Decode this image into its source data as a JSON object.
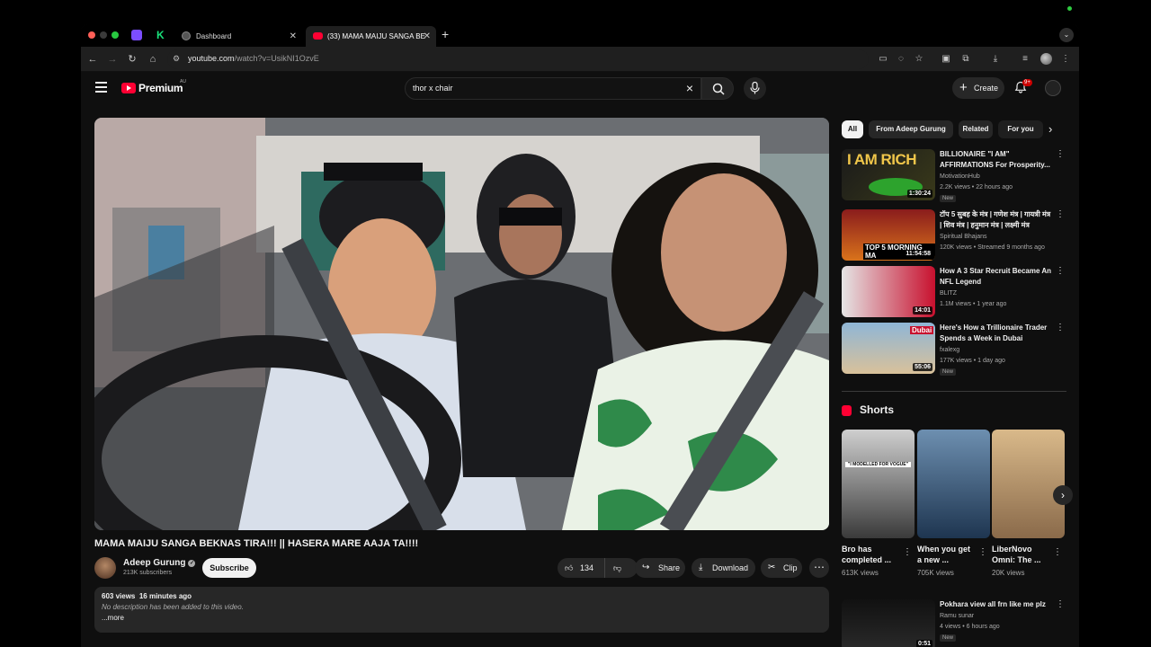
{
  "browser": {
    "tabs": [
      {
        "title": "Dashboard"
      },
      {
        "title": "(33) MAMA MAIJU SANGA BE",
        "active": true
      }
    ],
    "url_host": "youtube.com",
    "url_path": "/watch?v=UsikNI1OzvE"
  },
  "youtube": {
    "brand": "Premium",
    "country": "AU",
    "search_query": "thor x chair",
    "create_label": "Create",
    "notifications": "9+"
  },
  "video": {
    "title": "MAMA MAIJU SANGA BEKNAS TIRA!!! || HASERA MARE AAJA TA!!!!",
    "channel": "Adeep Gurung",
    "subscribers": "213K subscribers",
    "subscribe_label": "Subscribe",
    "likes": "134",
    "share_label": "Share",
    "download_label": "Download",
    "clip_label": "Clip",
    "views": "603 views",
    "uploaded": "16 minutes ago",
    "description": "No description has been added to this video.",
    "more_label": "...more"
  },
  "filters": [
    "All",
    "From Adeep Gurung",
    "Related",
    "For you"
  ],
  "recommendations": [
    {
      "title": "BILLIONAIRE \"I AM\" AFFIRMATIONS For Prosperity...",
      "channel": "MotivationHub",
      "meta": "2.2K views • 22 hours ago",
      "badge": "New",
      "duration": "1:30:24",
      "thumb_text": "I AM RICH"
    },
    {
      "title": "टॉप 5 सुबह के मंत्र | गणेश मंत्र | गायत्री मंत्र | शिव मंत्र | हनुमान मंत्र | लक्ष्मी मंत्र",
      "channel": "Spiritual Bhajans",
      "meta": "120K views • Streamed 9 months ago",
      "badge": "",
      "duration": "11:54:58",
      "thumb_text": "TOP 5 MORNING MA"
    },
    {
      "title": "How A 3 Star Recruit Became An NFL Legend",
      "channel": "BLITZ",
      "meta": "1.1M views • 1 year ago",
      "badge": "",
      "duration": "14:01",
      "thumb_text": ""
    },
    {
      "title": "Here's How a Trillionaire Trader Spends a Week in Dubai",
      "channel": "fxalexg",
      "meta": "177K views • 1 day ago",
      "badge": "New",
      "duration": "55:06",
      "thumb_text": "Dubai"
    }
  ],
  "shorts_heading": "Shorts",
  "shorts": [
    {
      "title": "Bro has completed ...",
      "views": "613K views",
      "overlay": "\"I MODELLED FOR VOGUE\""
    },
    {
      "title": "When you get a new ...",
      "views": "705K views"
    },
    {
      "title": "LiberNovo Omni: The ...",
      "views": "20K views"
    }
  ],
  "bottom_rec": {
    "title": "Pokhara view all frn like me plz",
    "channel": "Ramu sunar",
    "meta": "4 views • 6 hours ago",
    "badge": "New",
    "duration": "0:51"
  },
  "colors": {
    "background": "#0f0f0f",
    "surface": "#272727",
    "brand_red": "#ff0033",
    "text_secondary": "#aaaaaa"
  }
}
